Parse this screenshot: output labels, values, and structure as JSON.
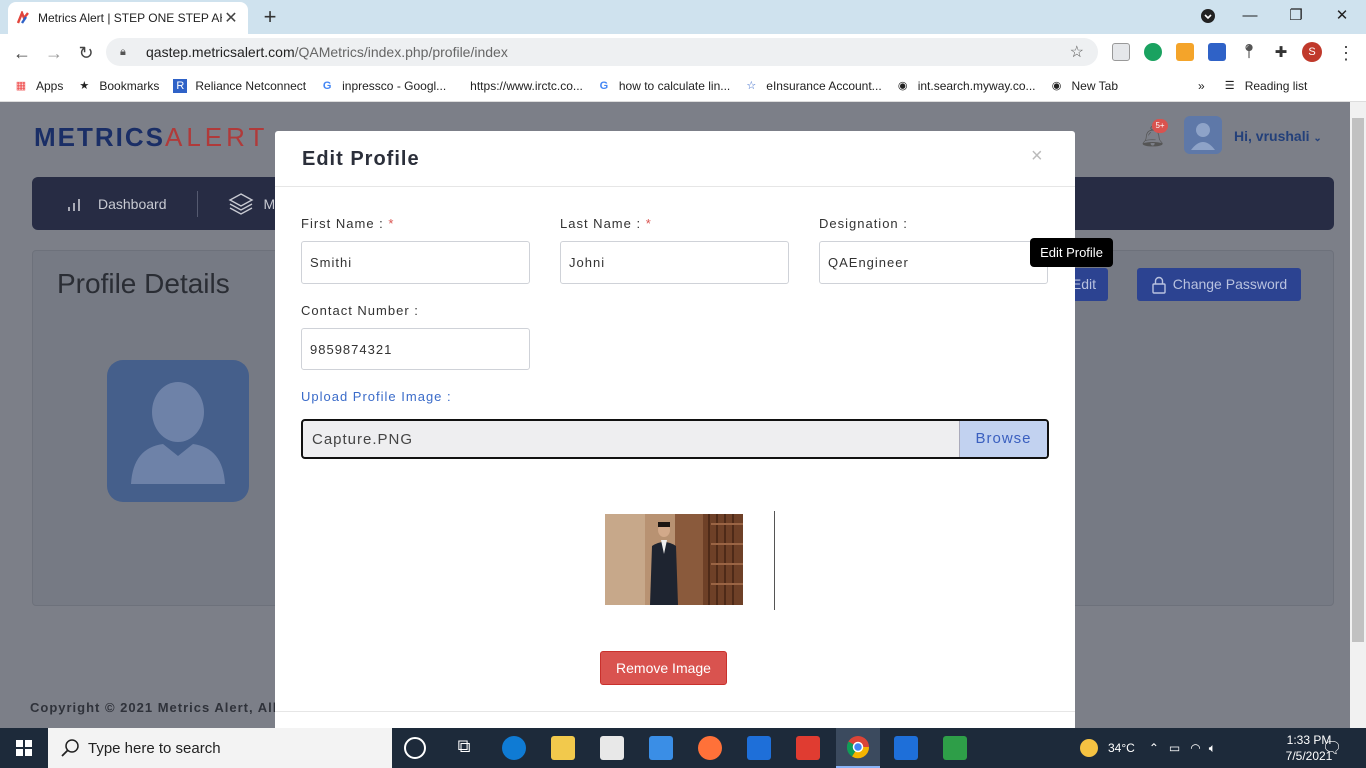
{
  "browser": {
    "tab_title": "Metrics Alert | STEP ONE STEP AH",
    "url_host": "qastep.metricsalert.com",
    "url_path": "/QAMetrics/index.php/profile/index",
    "profile_initial": "S",
    "bookmarks": [
      {
        "label": "Apps",
        "icon": "apps-grid-icon"
      },
      {
        "label": "Bookmarks",
        "icon": "star-icon"
      },
      {
        "label": "Reliance Netconnect",
        "icon": "reliance-icon"
      },
      {
        "label": "inpressco - Googl...",
        "icon": "google-icon"
      },
      {
        "label": "https://www.irctc.co...",
        "icon": "blank-page-icon"
      },
      {
        "label": "how to calculate lin...",
        "icon": "google-icon"
      },
      {
        "label": "eInsurance Account...",
        "icon": "einsurance-icon"
      },
      {
        "label": "int.search.myway.co...",
        "icon": "globe-icon"
      },
      {
        "label": "New Tab",
        "icon": "globe-icon"
      }
    ],
    "reading_list": "Reading list"
  },
  "app": {
    "logo_main": "METRICS",
    "logo_accent": "ALERT",
    "notification_badge": "5+",
    "greeting": "Hi, vrushali",
    "nav": [
      {
        "label": "Dashboard",
        "icon": "bar-chart-icon"
      },
      {
        "label": "M",
        "icon": "layers-icon"
      }
    ],
    "profile_title": "Profile Details",
    "edit_button": "Edit",
    "change_password_button": "Change Password",
    "copyright": "Copyright © 2021 Metrics Alert, All"
  },
  "modal": {
    "title": "Edit Profile",
    "close": "×",
    "first_name_label": "First Name :",
    "first_name_value": "Smithi",
    "last_name_label": "Last Name :",
    "last_name_value": "Johni",
    "designation_label": "Designation :",
    "designation_value": "QAEngineer",
    "contact_label": "Contact Number :",
    "contact_value": "9859874321",
    "required_marker": "*",
    "upload_label": "Upload Profile Image :",
    "file_name": "Capture.PNG",
    "browse_label": "Browse",
    "remove_image": "Remove Image"
  },
  "tooltip": "Edit Profile",
  "taskbar": {
    "search_placeholder": "Type here to search",
    "temperature": "34°C",
    "time": "1:33 PM",
    "date": "7/5/2021"
  },
  "colors": {
    "navbar": "#272c44",
    "primary_button": "#2c4391",
    "danger": "#d9534f",
    "link_blue": "#3a6bc9"
  }
}
